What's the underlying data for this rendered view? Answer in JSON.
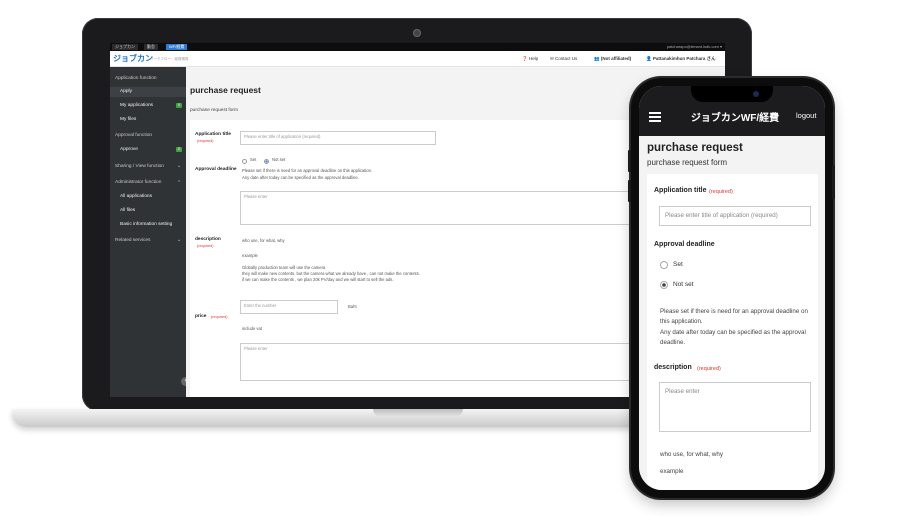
{
  "laptop": {
    "topbar": {
      "tabs": [
        "ジョブカン",
        "勤怠",
        "WF/経費"
      ],
      "active_tab": "WF/経費",
      "user_email": "patcharapo@tenant.lsdk.com ▾"
    },
    "header": {
      "logo": "ジョブカン",
      "logo_sub": "ワークフロー・経費精算",
      "links": {
        "help": "Help",
        "contact": "Contact Us",
        "affiliation": "(Not affiliated)",
        "user": "Pattanakimhun Patchara さん"
      }
    },
    "sidebar": {
      "application_function": "Application function",
      "apply": "Apply",
      "my_applications": "My applications",
      "my_applications_badge": "0",
      "my_files": "My files",
      "approval_function": "Approval function",
      "approve": "Approve",
      "approve_badge": "0",
      "sharing": "Sharing / View function",
      "admin": "Administrator function",
      "all_applications": "All applications",
      "all_files": "All files",
      "basic_info": "Basic information setting",
      "related": "Related services"
    },
    "main": {
      "title": "purchase request",
      "subtitle": "purchase request form",
      "app_title_label": "Application title",
      "required": "(required)",
      "app_title_placeholder": "Please enter title of application (required)",
      "deadline_label": "Approval deadline",
      "radio_set": "Set",
      "radio_not_set": "Not set",
      "deadline_note_1": "Please set if there is need for an approval deadline on this application.",
      "deadline_note_2": "Any date after today can be specified as the approval deadline.",
      "desc_placeholder": "Please enter",
      "desc_label": "description",
      "desc_hint": "who use, for what, why",
      "example": "example",
      "example_1": "Globally production team will use the camera",
      "example_2": "they will make new contents. but the camera what we already have , can not make the contents.",
      "example_3": "if we can make the contents , we plan 20k PV/day and we will start to sell the ads.",
      "price_label": "price",
      "price_placeholder": "Enter the number",
      "price_unit": "Baht",
      "include_vat": "include vat",
      "notes_placeholder": "Please enter"
    }
  },
  "phone": {
    "app_title": "ジョブカンWF/経費",
    "logout": "logout",
    "title": "purchase request",
    "subtitle": "purchase request form",
    "app_title_label": "Application title",
    "required": "(required)",
    "app_title_placeholder": "Please enter title of application (required)",
    "deadline_label": "Approval deadline",
    "radio_set": "Set",
    "radio_not_set": "Not set",
    "deadline_note_1": "Please set if there is need for an approval deadline on",
    "deadline_note_2": "this application.",
    "deadline_note_3": "Any date after today can be specified as the approval",
    "deadline_note_4": "deadline.",
    "desc_label": "description",
    "desc_placeholder": "Please enter",
    "desc_hint": "who use, for what, why",
    "example": "example"
  },
  "colors": {
    "accent": "#2f7dd1",
    "sidebar": "#303336",
    "required": "#dd3333",
    "badge": "#43a047"
  }
}
